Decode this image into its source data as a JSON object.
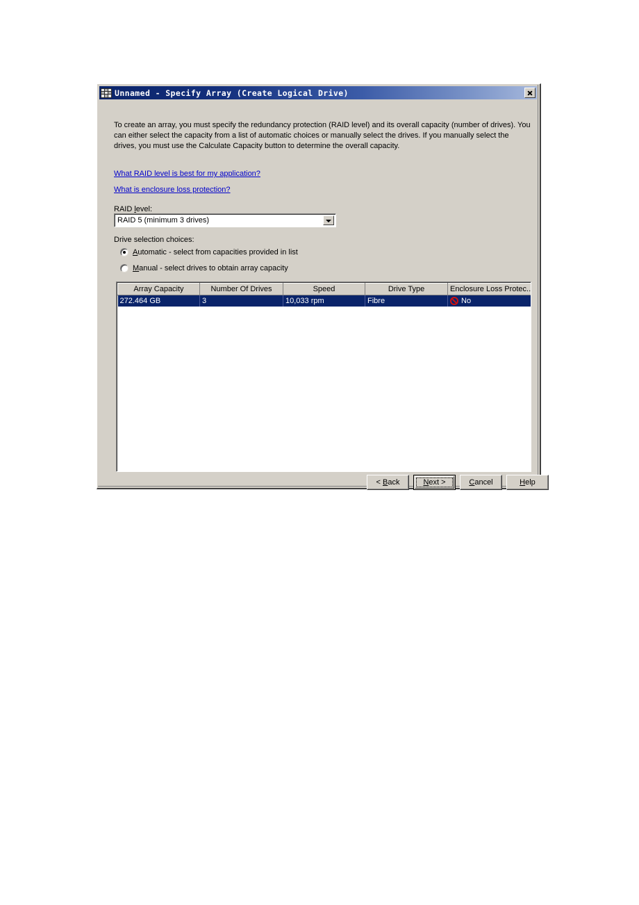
{
  "window": {
    "title": "Unnamed - Specify Array (Create Logical Drive)",
    "icon": "array-grid-icon",
    "close_label": "Close"
  },
  "description": "To create an array, you must specify the redundancy protection (RAID level) and its overall capacity (number of drives). You can either select the capacity from a list of automatic choices or manually select the drives. If you manually select the drives, you must use the Calculate Capacity button to determine the overall capacity.",
  "links": [
    {
      "text": "What RAID level is best for my application?"
    },
    {
      "text": "What is enclosure loss protection?"
    }
  ],
  "raid": {
    "label": "RAID level:",
    "label_prefix": "RAID ",
    "label_mnemonic": "l",
    "label_suffix": "evel:",
    "selected": "RAID 5 (minimum 3 drives)",
    "options": [
      "RAID 5 (minimum 3 drives)"
    ]
  },
  "drive_selection": {
    "label": "Drive selection choices:",
    "options": [
      {
        "mnemonic": "A",
        "text": "utomatic - select from capacities provided in list",
        "selected": true
      },
      {
        "mnemonic": "M",
        "text": "anual - select drives to obtain array capacity",
        "selected": false
      }
    ]
  },
  "table": {
    "columns": [
      "Array Capacity",
      "Number Of Drives",
      "Speed",
      "Drive Type",
      "Enclosure Loss Protec..."
    ],
    "rows": [
      {
        "array_capacity": "272.464 GB",
        "number_of_drives": "3",
        "speed": "10,033 rpm",
        "drive_type": "Fibre",
        "enclosure_loss_protection": "No",
        "enclosure_icon": "prohibition-icon",
        "selected": true
      }
    ]
  },
  "buttons": {
    "back": {
      "prefix": "< ",
      "mnemonic": "B",
      "suffix": "ack"
    },
    "next": {
      "prefix": "",
      "mnemonic": "N",
      "suffix": "ext >",
      "is_default": true
    },
    "cancel": {
      "prefix": "",
      "mnemonic": "C",
      "suffix": "ancel"
    },
    "help": {
      "prefix": "",
      "mnemonic": "H",
      "suffix": "elp"
    }
  },
  "colors": {
    "dialog_face": "#d4d0c8",
    "title_start": "#0a246a",
    "title_end": "#a6b8dc",
    "link": "#0000cc",
    "selection": "#0a246a",
    "prohibition": "#cc1111"
  }
}
